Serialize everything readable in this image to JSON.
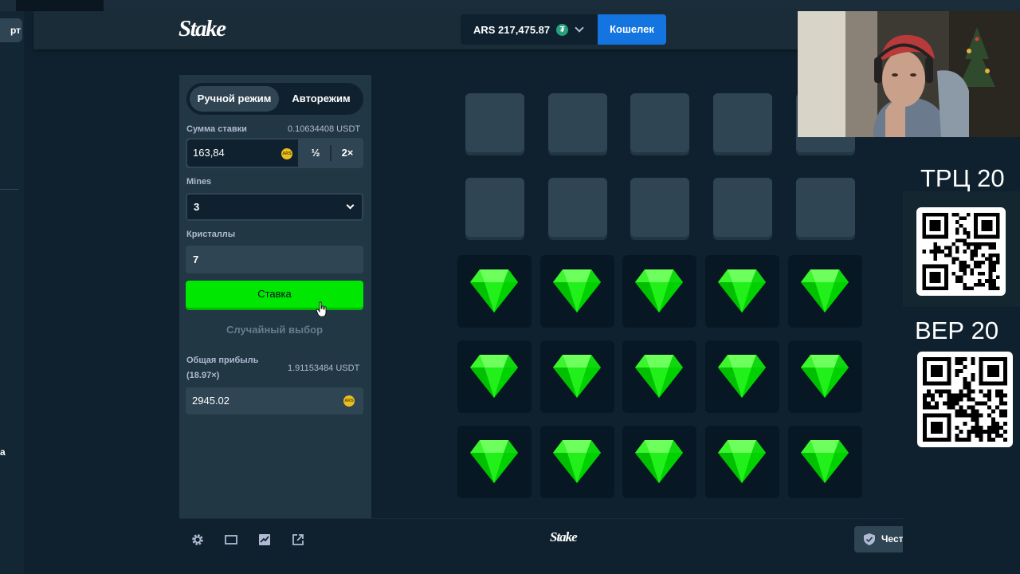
{
  "header": {
    "logo": "Stake",
    "balance": "ARS 217,475.87",
    "currency_badge": "₮",
    "wallet_label": "Кошелек"
  },
  "left_sidebar": {
    "pill_fragment": "рт",
    "text_fragment": "а"
  },
  "panel": {
    "mode_manual": "Ручной режим",
    "mode_auto": "Авторежим",
    "bet_amount_label": "Сумма ставки",
    "bet_amount_converted": "0.10634408 USDT",
    "bet_amount_value": "163,84",
    "currency_code": "ARS",
    "half_label": "½",
    "double_label": "2×",
    "mines_label": "Mines",
    "mines_value": "3",
    "gems_label": "Кристаллы",
    "gems_value": "7",
    "bet_button": "Ставка",
    "random_pick_button": "Случайный выбор",
    "profit_label": "Общая прибыль",
    "profit_multiplier": "(18.97×)",
    "profit_converted": "1.91153484 USDT",
    "profit_value": "2945.02"
  },
  "board": {
    "rows": 5,
    "cols": 5,
    "cells": [
      "hidden",
      "hidden",
      "hidden",
      "hidden",
      "hidden",
      "hidden",
      "hidden",
      "hidden",
      "hidden",
      "hidden",
      "gem",
      "gem",
      "gem",
      "gem",
      "gem",
      "gem",
      "gem",
      "gem",
      "gem",
      "gem",
      "gem",
      "gem",
      "gem",
      "gem",
      "gem"
    ],
    "gem_color": "#00e701"
  },
  "footer": {
    "logo": "Stake",
    "fairness_label": "Честность"
  },
  "overlay": {
    "promo_1": "ТРЦ 20",
    "promo_2": "ВЕР 20"
  },
  "colors": {
    "accent_green": "#00e701",
    "wallet_blue": "#1475e1",
    "panel_bg": "#213743",
    "page_bg": "#0f212e"
  }
}
